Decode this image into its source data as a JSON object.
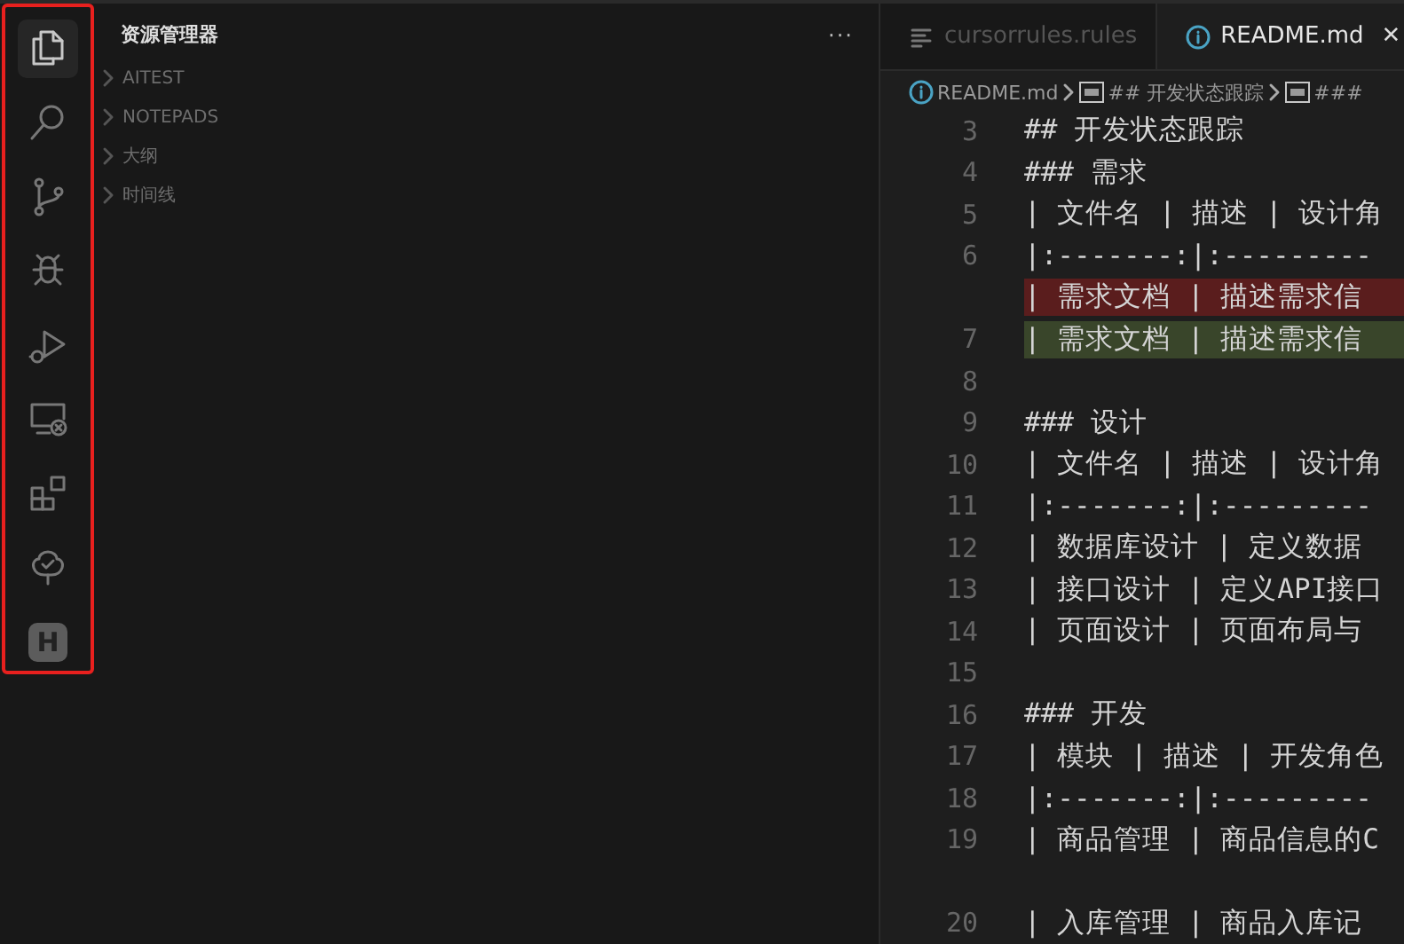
{
  "activity_bar": {
    "highlighted": true,
    "items": [
      {
        "kind": "files",
        "selected": true
      },
      {
        "kind": "search",
        "selected": false
      },
      {
        "kind": "branch",
        "selected": false
      },
      {
        "kind": "bug",
        "selected": false
      },
      {
        "kind": "run",
        "selected": false
      },
      {
        "kind": "remote",
        "selected": false
      },
      {
        "kind": "extensions",
        "selected": false
      },
      {
        "kind": "tree",
        "selected": false
      },
      {
        "kind": "account",
        "label": "H",
        "selected": false
      }
    ]
  },
  "sidebar": {
    "title": "资源管理器",
    "more": "···",
    "sections": [
      {
        "label": "AITEST",
        "expanded": false
      },
      {
        "label": "NOTEPADS",
        "expanded": false
      },
      {
        "label": "大纲",
        "expanded": false
      },
      {
        "label": "时间线",
        "expanded": false
      }
    ]
  },
  "tabs": [
    {
      "label": "cursorrules.rules",
      "kind": "rules",
      "selected": false
    },
    {
      "label": "README.md",
      "kind": "info",
      "selected": true,
      "close": "✕"
    }
  ],
  "breadcrumbs": [
    {
      "label": "README.md",
      "kind": "info"
    },
    {
      "label": "## 开发状态跟踪",
      "kind": "heading"
    },
    {
      "label": "###",
      "kind": "heading"
    }
  ],
  "lines": [
    {
      "number": "3",
      "text": "## 开发状态跟踪",
      "kind": "normal"
    },
    {
      "number": "4",
      "text": "### 需求",
      "kind": "normal"
    },
    {
      "number": "5",
      "text": "| 文件名 | 描述 | 设计角",
      "kind": "normal"
    },
    {
      "number": "6",
      "text": "|:-------:|:---------",
      "kind": "normal"
    },
    {
      "text": "| 需求文档 | 描述需求信",
      "kind": "deleted"
    },
    {
      "number": "7",
      "text": "| 需求文档 | 描述需求信",
      "kind": "added"
    },
    {
      "number": "8",
      "kind": "normal"
    },
    {
      "number": "9",
      "text": "### 设计",
      "kind": "normal"
    },
    {
      "number": "10",
      "text": "| 文件名 | 描述 | 设计角",
      "kind": "normal"
    },
    {
      "number": "11",
      "text": "|:-------:|:---------",
      "kind": "normal"
    },
    {
      "number": "12",
      "text": "| 数据库设计 | 定义数据",
      "kind": "normal"
    },
    {
      "number": "13",
      "text": "| 接口设计 | 定义API接口",
      "kind": "normal"
    },
    {
      "number": "14",
      "text": "| 页面设计 | 页面布局与",
      "kind": "normal"
    },
    {
      "number": "15",
      "kind": "normal"
    },
    {
      "number": "16",
      "text": "### 开发",
      "kind": "normal"
    },
    {
      "number": "17",
      "text": "| 模块 | 描述 | 开发角色",
      "kind": "normal"
    },
    {
      "number": "18",
      "text": "|:-------:|:---------",
      "kind": "normal"
    },
    {
      "number": "19",
      "text": "| 商品管理 | 商品信息的C",
      "kind": "normal"
    },
    {
      "kind": "wrap"
    },
    {
      "number": "20",
      "text": "| 入库管理 | 商品入库记",
      "kind": "normal"
    }
  ]
}
